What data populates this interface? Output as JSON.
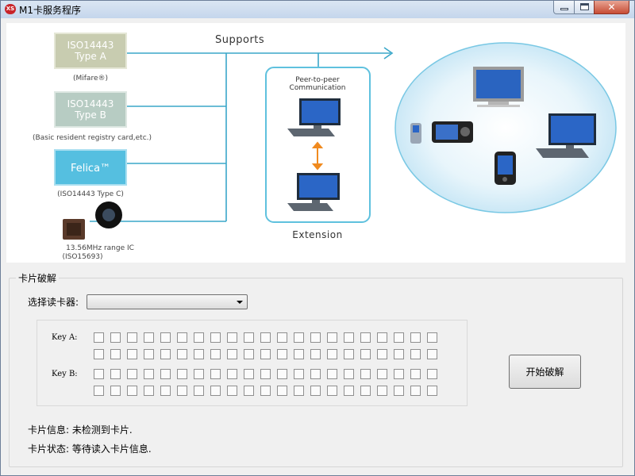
{
  "window": {
    "title": "M1卡服务程序",
    "app_icon_text": "XS"
  },
  "caption_buttons": {
    "close_glyph": "✕"
  },
  "banner": {
    "supports_label": "Supports",
    "cards": [
      {
        "name": "ISO14443\nType A",
        "caption": "(Mifare®)"
      },
      {
        "name": "ISO14443\nType B",
        "caption": "(Basic resident registry card,etc.)"
      },
      {
        "name": "Felica™",
        "caption": "(ISO14443 Type C)"
      }
    ],
    "ic_caption": [
      "13.56MHz range IC",
      "(ISO15693)"
    ],
    "p2p_title": [
      "Peer-to-peer",
      "Communication"
    ],
    "extension_label": "Extension"
  },
  "crack_group": {
    "title": "卡片破解",
    "reader_label": "选择读卡器:",
    "reader_selected": "",
    "key_a_label": "Key A:",
    "key_b_label": "Key B:",
    "key_a_rows": [
      [
        "",
        "",
        "",
        "",
        "",
        "",
        "",
        "",
        "",
        "",
        "",
        "",
        "",
        "",
        "",
        "",
        "",
        "",
        "",
        "",
        ""
      ],
      [
        "",
        "",
        "",
        "",
        "",
        "",
        "",
        "",
        "",
        "",
        "",
        "",
        "",
        "",
        "",
        "",
        "",
        "",
        "",
        "",
        ""
      ]
    ],
    "key_b_rows": [
      [
        "",
        "",
        "",
        "",
        "",
        "",
        "",
        "",
        "",
        "",
        "",
        "",
        "",
        "",
        "",
        "",
        "",
        "",
        "",
        "",
        ""
      ],
      [
        "",
        "",
        "",
        "",
        "",
        "",
        "",
        "",
        "",
        "",
        "",
        "",
        "",
        "",
        "",
        "",
        "",
        "",
        "",
        "",
        ""
      ]
    ],
    "start_button": "开始破解",
    "card_info": "卡片信息: 未检测到卡片.",
    "card_status": "卡片状态: 等待读入卡片信息."
  }
}
